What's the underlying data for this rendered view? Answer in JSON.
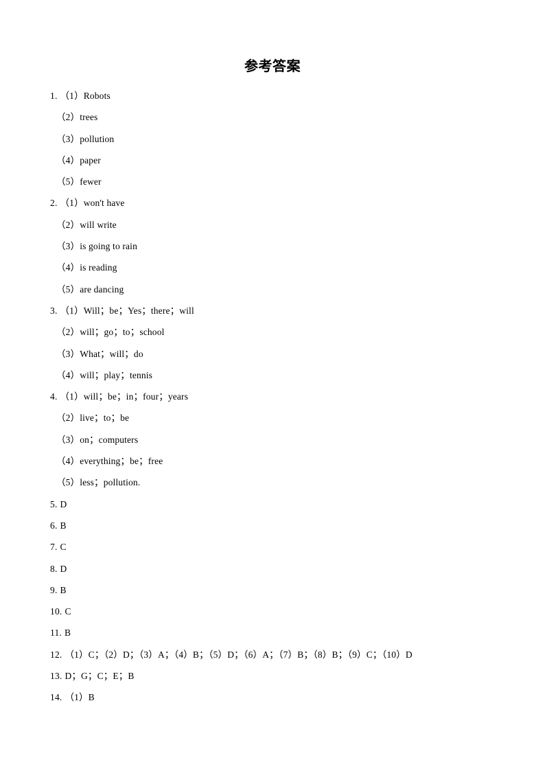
{
  "document": {
    "title": "参考答案",
    "page_background": "#ffffff",
    "text_color": "#000000"
  },
  "answers": [
    {
      "number": "1.",
      "text": "（1）Robots",
      "indent": false
    },
    {
      "number": "",
      "text": "（2）trees",
      "indent": true
    },
    {
      "number": "",
      "text": "（3）pollution",
      "indent": true
    },
    {
      "number": "",
      "text": "（4）paper",
      "indent": true
    },
    {
      "number": "",
      "text": "（5）fewer",
      "indent": true
    },
    {
      "number": "2.",
      "text": "（1）won't have",
      "indent": false
    },
    {
      "number": "",
      "text": "（2）will write",
      "indent": true
    },
    {
      "number": "",
      "text": "（3）is going to rain",
      "indent": true
    },
    {
      "number": "",
      "text": "（4）is reading",
      "indent": true
    },
    {
      "number": "",
      "text": "（5）are dancing",
      "indent": true
    },
    {
      "number": "3.",
      "text": "（1）Will；be；Yes；there；will",
      "indent": false
    },
    {
      "number": "",
      "text": "（2）will；go；to；school",
      "indent": true
    },
    {
      "number": "",
      "text": "（3）What；will；do",
      "indent": true
    },
    {
      "number": "",
      "text": "（4）will；play；tennis",
      "indent": true
    },
    {
      "number": "4.",
      "text": "（1）will；be；in；four；years",
      "indent": false
    },
    {
      "number": "",
      "text": "（2）live；to；be",
      "indent": true
    },
    {
      "number": "",
      "text": "（3）on；computers",
      "indent": true
    },
    {
      "number": "",
      "text": "（4）everything；be；free",
      "indent": true
    },
    {
      "number": "",
      "text": "（5）less；pollution.",
      "indent": true
    },
    {
      "number": "5.",
      "text": "D",
      "indent": false
    },
    {
      "number": "6.",
      "text": "B",
      "indent": false
    },
    {
      "number": "7.",
      "text": "C",
      "indent": false
    },
    {
      "number": "8.",
      "text": "D",
      "indent": false
    },
    {
      "number": "9.",
      "text": "B",
      "indent": false
    },
    {
      "number": "10.",
      "text": "C",
      "indent": false
    },
    {
      "number": "11.",
      "text": "B",
      "indent": false
    },
    {
      "number": "12.",
      "text": "（1）C；（2）D；（3）A；（4）B；（5）D；（6）A；（7）B；（8）B；（9）C；（10）D",
      "indent": false
    },
    {
      "number": "13.",
      "text": "D；G；C；E；B",
      "indent": false
    },
    {
      "number": "14.",
      "text": "（1）B",
      "indent": false
    }
  ]
}
